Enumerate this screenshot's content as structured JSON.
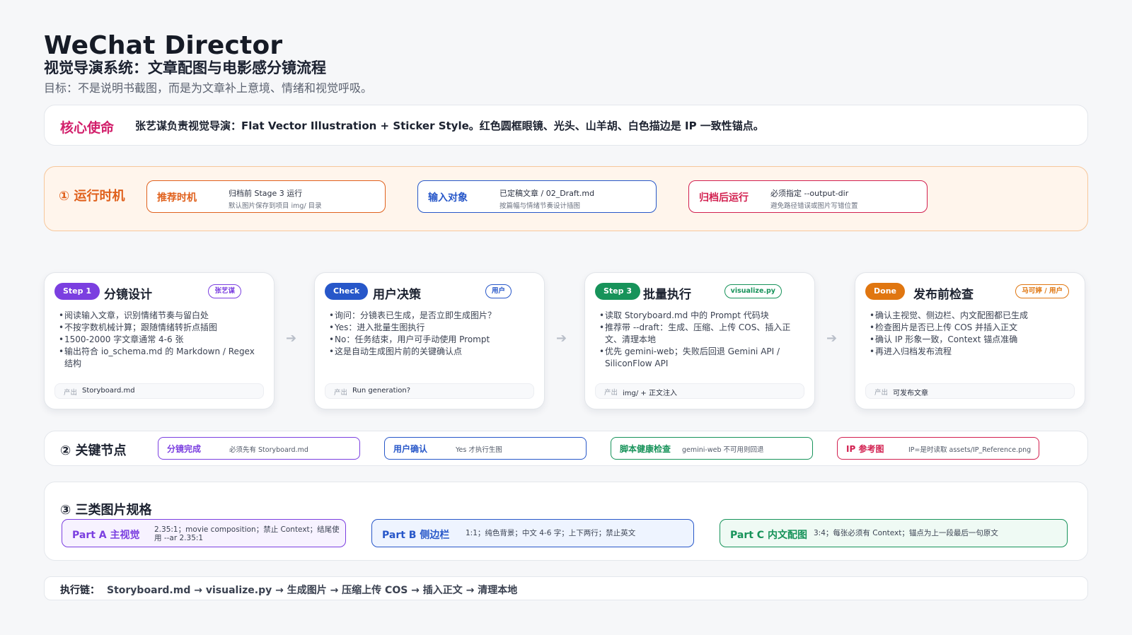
{
  "header": {
    "title": "WeChat Director",
    "subtitle": "视觉导演系统：文章配图与电影感分镜流程",
    "goal": "目标：不是说明书截图，而是为文章补上意境、情绪和视觉呼吸。"
  },
  "mission": {
    "label": "核心使命",
    "text": "张艺谋负责视觉导演：Flat Vector Illustration + Sticker Style。红色圆框眼镜、光头、山羊胡、白色描边是 IP 一致性锚点。"
  },
  "runtime": {
    "label": "① 运行时机",
    "boxes": [
      {
        "head": "推荐时机",
        "main": "归档前 Stage 3 运行",
        "sub": "默认图片保存到项目 img/ 目录",
        "color": "#e0611d"
      },
      {
        "head": "输入对象",
        "main": "已定稿文章 / 02_Draft.md",
        "sub": "按篇幅与情绪节奏设计插图",
        "color": "#2757c9"
      },
      {
        "head": "归档后运行",
        "main": "必须指定 --output-dir",
        "sub": "避免路径错误或图片写错位置",
        "color": "#d21f4f"
      }
    ]
  },
  "steps": [
    {
      "pill": "Step 1",
      "pill_color": "#7b3fe0",
      "title": "分镜设计",
      "owner": "张艺谋",
      "owner_color": "#7b3fe0",
      "bullets": [
        "阅读输入文章，识别情绪节奏与留白处",
        "不按字数机械计算；跟随情绪转折点插图",
        "1500-2000 字文章通常 4-6 张",
        "输出符合 io_schema.md 的 Markdown / Regex 结构"
      ],
      "output_label": "产出",
      "output": "Storyboard.md"
    },
    {
      "pill": "Check",
      "pill_color": "#2757c9",
      "title": "用户决策",
      "owner": "用户",
      "owner_color": "#2757c9",
      "bullets": [
        "询问：分镜表已生成，是否立即生成图片？",
        "Yes：进入批量生图执行",
        "No：任务结束，用户可手动使用 Prompt",
        "这是自动生成图片前的关键确认点"
      ],
      "output_label": "产出",
      "output": "Run generation?"
    },
    {
      "pill": "Step 3",
      "pill_color": "#17935a",
      "title": "批量执行",
      "owner": "visualize.py",
      "owner_color": "#17935a",
      "bullets": [
        "读取 Storyboard.md 中的 Prompt 代码块",
        "推荐带 --draft：生成、压缩、上传 COS、插入正文、清理本地",
        "优先 gemini-web；失败后回退 Gemini API / SiliconFlow API"
      ],
      "output_label": "产出",
      "output": "img/ + 正文注入"
    },
    {
      "pill": "Done",
      "pill_color": "#e07610",
      "title": "发布前检查",
      "owner": "马可婷 / 用户",
      "owner_color": "#e07610",
      "bullets": [
        "确认主视觉、侧边栏、内文配图都已生成",
        "检查图片是否已上传 COS 并插入正文",
        "确认 IP 形象一致，Context 锚点准确",
        "再进入归档发布流程"
      ],
      "output_label": "产出",
      "output": "可发布文章"
    }
  ],
  "keynodes": {
    "label": "② 关键节点",
    "items": [
      {
        "head": "分镜完成",
        "value": "必须先有 Storyboard.md",
        "color": "#7b3fe0"
      },
      {
        "head": "用户确认",
        "value": "Yes 才执行生图",
        "color": "#2757c9"
      },
      {
        "head": "脚本健康检查",
        "value": "gemini-web 不可用则回退",
        "color": "#17935a"
      },
      {
        "head": "IP 参考图",
        "value": "IP=是时读取 assets/IP_Reference.png",
        "color": "#d21f4f"
      }
    ]
  },
  "specs": {
    "label": "③ 三类图片规格",
    "items": [
      {
        "head": "Part A 主视觉",
        "value": "2.35:1；movie composition；禁止 Context；结尾使用 --ar 2.35:1",
        "color": "#7b3fe0",
        "bg": "#f7f2ff"
      },
      {
        "head": "Part B 侧边栏",
        "value": "1:1；纯色背景；中文 4-6 字；上下两行；禁止英文",
        "color": "#2757c9",
        "bg": "#eef4ff"
      },
      {
        "head": "Part C 内文配图",
        "value": "3:4；每张必须有 Context；锚点为上一段最后一句原文",
        "color": "#17935a",
        "bg": "#effaf4"
      }
    ]
  },
  "chain": {
    "label": "执行链：",
    "value": "Storyboard.md → visualize.py → 生成图片 → 压缩上传 COS → 插入正文 → 清理本地"
  }
}
